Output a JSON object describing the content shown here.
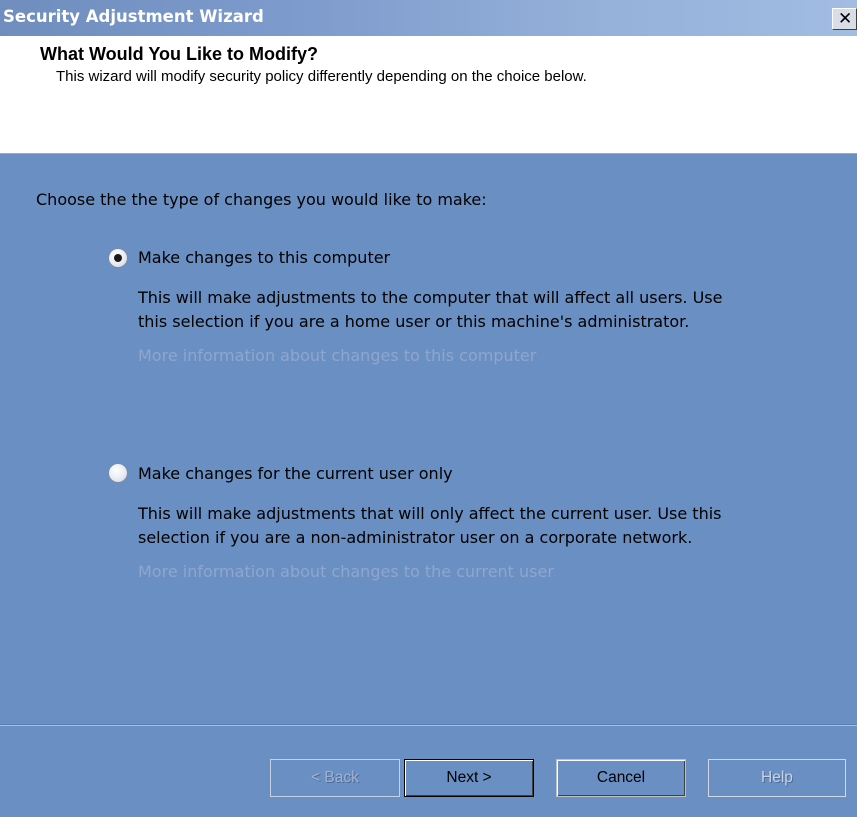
{
  "window": {
    "title": "Security Adjustment Wizard",
    "close_glyph": "✕"
  },
  "header": {
    "title": "What Would You Like to Modify?",
    "description": "This wizard will modify security policy differently depending on the choice below."
  },
  "main": {
    "prompt": "Choose the the type of changes you would like to make:",
    "options": [
      {
        "label": "Make changes to this computer",
        "selected": true,
        "description_lines": [
          "This will make adjustments to the computer that will affect all users.  Use",
          "this selection if you are a home user or this machine's administrator."
        ],
        "link": "More information about changes to this computer"
      },
      {
        "label": "Make changes for the current user only",
        "selected": false,
        "description_lines": [
          "This will make adjustments that will only affect the current user.  Use this",
          "selection if you are a non-administrator user on a corporate network."
        ],
        "link": "More information about changes to the current user"
      }
    ]
  },
  "footer": {
    "back_label": "< Back",
    "next_label": "Next >",
    "cancel_label": "Cancel",
    "help_label": "Help"
  },
  "colors": {
    "background": "#6a8fc2",
    "link": "#8fa6cf",
    "title_text": "#ffffff"
  }
}
